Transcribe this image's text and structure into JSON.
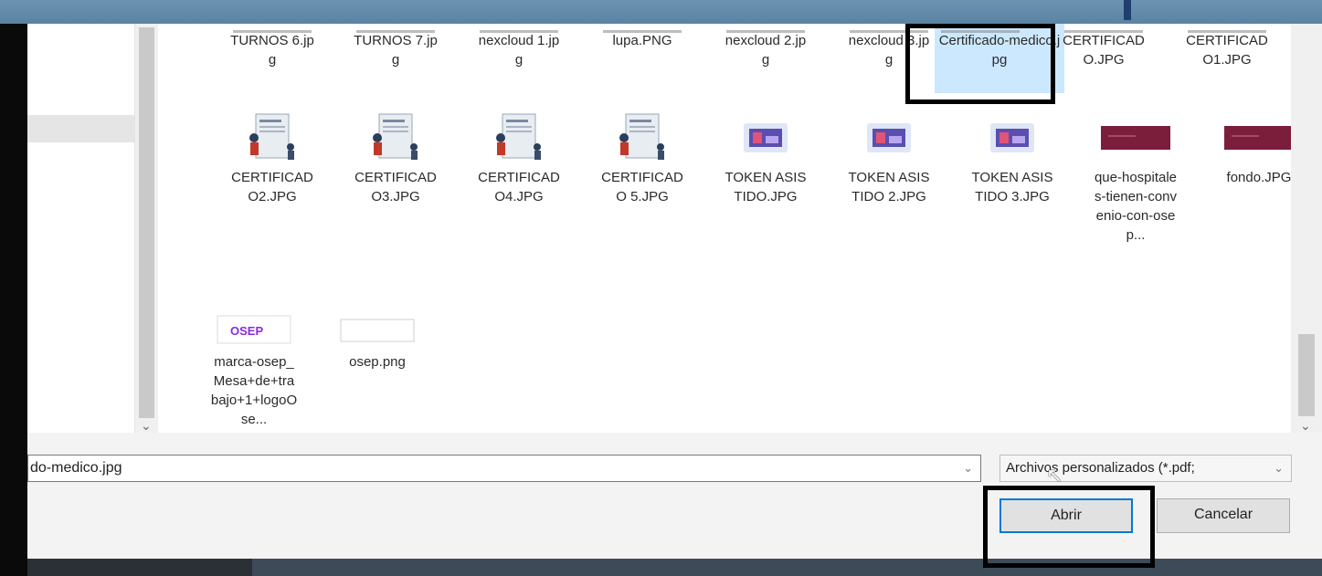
{
  "files": [
    {
      "name": "TURNOS 6.jpg",
      "icon": "image-stub-icon"
    },
    {
      "name": "TURNOS 7.jpg",
      "icon": "image-stub-icon"
    },
    {
      "name": "nexcloud 1.jpg",
      "icon": "image-stub-icon"
    },
    {
      "name": "lupa.PNG",
      "icon": "image-stub-icon"
    },
    {
      "name": "nexcloud 2.jpg",
      "icon": "image-stub-icon"
    },
    {
      "name": "nexcloud 3.jpg",
      "icon": "image-stub-icon"
    },
    {
      "name": "Certificado-medico.jpg",
      "icon": "image-stub-icon",
      "selected": true
    },
    {
      "name": "CERTIFICADO.JPG",
      "icon": "image-stub-icon"
    },
    {
      "name": "CERTIFICADO1.JPG",
      "icon": "image-stub-icon"
    },
    {
      "name": "CERTIFICADO2.JPG",
      "icon": "certificate-illustration-icon"
    },
    {
      "name": "CERTIFICADO3.JPG",
      "icon": "certificate-illustration-icon"
    },
    {
      "name": "CERTIFICADO4.JPG",
      "icon": "certificate-illustration-icon"
    },
    {
      "name": "CERTIFICADO 5.JPG",
      "icon": "certificate-illustration-icon"
    },
    {
      "name": "TOKEN ASISTIDO.JPG",
      "icon": "token-illustration-icon"
    },
    {
      "name": "TOKEN ASISTIDO 2.JPG",
      "icon": "token-illustration-icon"
    },
    {
      "name": "TOKEN ASISTIDO 3.JPG",
      "icon": "token-illustration-icon"
    },
    {
      "name": "que-hospitales-tienen-convenio-con-osep...",
      "icon": "maroon-banner-icon"
    },
    {
      "name": "fondo.JPG",
      "icon": "maroon-banner-icon"
    },
    {
      "name": "marca-osep_Mesa+de+trabajo+1+logoOse...",
      "icon": "osep-logo-icon",
      "logo_text": "OSEP"
    },
    {
      "name": "osep.png",
      "icon": "blank-image-icon"
    }
  ],
  "filename_field": {
    "value": "do-medico.jpg"
  },
  "filetype_select": {
    "value": "Archivos personalizados (*.pdf;"
  },
  "buttons": {
    "open": "Abrir",
    "cancel": "Cancelar"
  },
  "colors": {
    "selection": "#cce8ff",
    "primary_border": "#0078d7",
    "osep_purple": "#8a2be2",
    "banner_maroon": "#7a1e3c"
  }
}
